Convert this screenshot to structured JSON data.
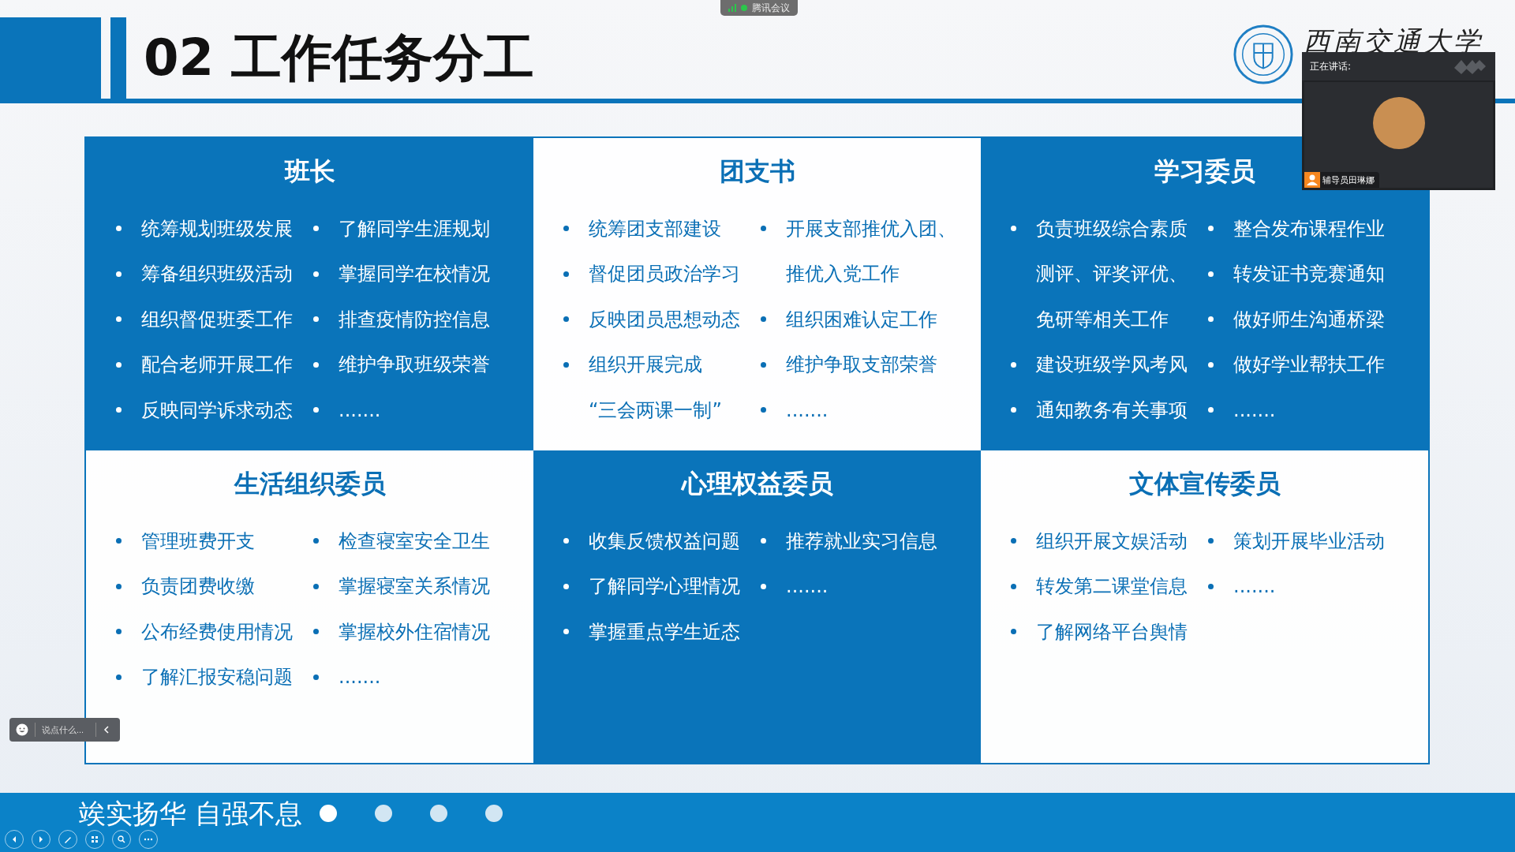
{
  "meeting_tag": {
    "label": "腾讯会议"
  },
  "header": {
    "title": "02 工作任务分工",
    "logo_text": "西南交通大学"
  },
  "cells": [
    {
      "title": "班长",
      "kind": "blue",
      "left": [
        {
          "text": "统筹规划班级发展",
          "bullet": true
        },
        {
          "text": "筹备组织班级活动",
          "bullet": true
        },
        {
          "text": "组织督促班委工作",
          "bullet": true
        },
        {
          "text": "配合老师开展工作",
          "bullet": true
        },
        {
          "text": "反映同学诉求动态",
          "bullet": true
        }
      ],
      "right": [
        {
          "text": "了解同学生涯规划",
          "bullet": true
        },
        {
          "text": "掌握同学在校情况",
          "bullet": true
        },
        {
          "text": "排查疫情防控信息",
          "bullet": true
        },
        {
          "text": "维护争取班级荣誉",
          "bullet": true
        },
        {
          "text": ".......",
          "bullet": true
        }
      ]
    },
    {
      "title": "团支书",
      "kind": "white",
      "left": [
        {
          "text": "统筹团支部建设",
          "bullet": true
        },
        {
          "text": "督促团员政治学习",
          "bullet": true
        },
        {
          "text": "反映团员思想动态",
          "bullet": true
        },
        {
          "text": "组织开展完成",
          "bullet": true
        },
        {
          "text": "“三会两课一制”",
          "bullet": false
        }
      ],
      "right": [
        {
          "text": "开展支部推优入团、",
          "bullet": true
        },
        {
          "text": "推优入党工作",
          "bullet": false
        },
        {
          "text": "组织困难认定工作",
          "bullet": true
        },
        {
          "text": "维护争取支部荣誉",
          "bullet": true
        },
        {
          "text": ".......",
          "bullet": true
        }
      ]
    },
    {
      "title": "学习委员",
      "kind": "blue",
      "left": [
        {
          "text": "负责班级综合素质",
          "bullet": true
        },
        {
          "text": "测评、评奖评优、",
          "bullet": false
        },
        {
          "text": "免研等相关工作",
          "bullet": false
        },
        {
          "text": "建设班级学风考风",
          "bullet": true
        },
        {
          "text": "通知教务有关事项",
          "bullet": true
        }
      ],
      "right": [
        {
          "text": "整合发布课程作业",
          "bullet": true
        },
        {
          "text": "转发证书竞赛通知",
          "bullet": true
        },
        {
          "text": "做好师生沟通桥梁",
          "bullet": true
        },
        {
          "text": "做好学业帮扶工作",
          "bullet": true
        },
        {
          "text": ".......",
          "bullet": true
        }
      ]
    },
    {
      "title": "生活组织委员",
      "kind": "white",
      "left": [
        {
          "text": "管理班费开支",
          "bullet": true
        },
        {
          "text": "负责团费收缴",
          "bullet": true
        },
        {
          "text": "公布经费使用情况",
          "bullet": true
        },
        {
          "text": "了解汇报安稳问题",
          "bullet": true
        }
      ],
      "right": [
        {
          "text": "检查寝室安全卫生",
          "bullet": true
        },
        {
          "text": "掌握寝室关系情况",
          "bullet": true
        },
        {
          "text": "掌握校外住宿情况",
          "bullet": true
        },
        {
          "text": ".......",
          "bullet": true
        }
      ]
    },
    {
      "title": "心理权益委员",
      "kind": "blue",
      "left": [
        {
          "text": "收集反馈权益问题",
          "bullet": true
        },
        {
          "text": "了解同学心理情况",
          "bullet": true
        },
        {
          "text": "掌握重点学生近态",
          "bullet": true
        }
      ],
      "right": [
        {
          "text": "推荐就业实习信息",
          "bullet": true
        },
        {
          "text": ".......",
          "bullet": true
        }
      ]
    },
    {
      "title": "文体宣传委员",
      "kind": "white",
      "left": [
        {
          "text": "组织开展文娱活动",
          "bullet": true
        },
        {
          "text": "转发第二课堂信息",
          "bullet": true
        },
        {
          "text": "了解网络平台舆情",
          "bullet": true
        }
      ],
      "right": [
        {
          "text": "策划开展毕业活动",
          "bullet": true
        },
        {
          "text": ".......",
          "bullet": true
        }
      ]
    }
  ],
  "banner": {
    "motto": "竢实扬华 自强不息",
    "dots": [
      {
        "selected": true
      },
      {
        "selected": false
      },
      {
        "selected": false
      },
      {
        "selected": false
      }
    ]
  },
  "video_panel": {
    "heading": "正在讲话:",
    "name": "辅导员田琳娜"
  },
  "comment_bar": {
    "placeholder": "说点什么..."
  }
}
